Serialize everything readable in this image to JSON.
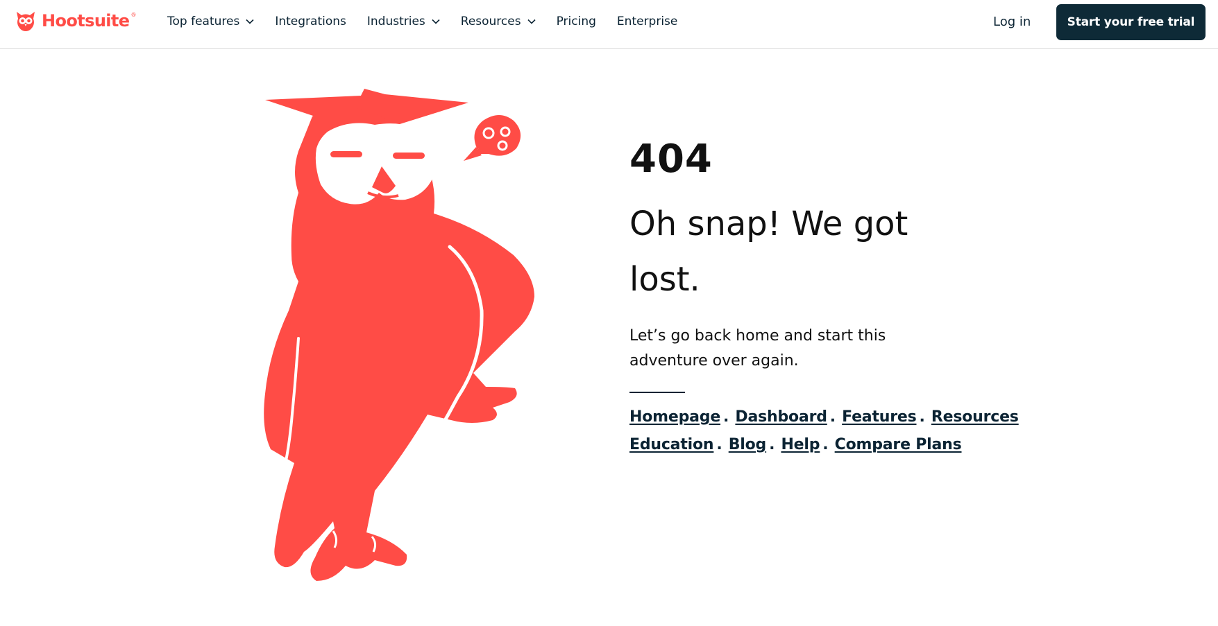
{
  "brand": {
    "name": "Hootsuite",
    "reg_mark": "®",
    "accent": "#ff4c46",
    "dark": "#0e2a37"
  },
  "nav": {
    "items": [
      {
        "label": "Top features",
        "dropdown": true
      },
      {
        "label": "Integrations",
        "dropdown": false
      },
      {
        "label": "Industries",
        "dropdown": true
      },
      {
        "label": "Resources",
        "dropdown": true
      },
      {
        "label": "Pricing",
        "dropdown": false
      },
      {
        "label": "Enterprise",
        "dropdown": false
      }
    ],
    "login_label": "Log in",
    "cta_label": "Start your free trial"
  },
  "error": {
    "code": "404",
    "heading": "Oh snap! We got lost.",
    "subtext": "Let’s go back home and start this adventure over again."
  },
  "links": [
    "Homepage",
    "Dashboard",
    "Features",
    "Resources",
    "Education",
    "Blog",
    "Help",
    "Compare Plans"
  ],
  "link_separator": ".",
  "icons": {
    "logo": "owl-logo-icon",
    "dropdown": "chevron-down-icon",
    "illustration": "owl-illustration",
    "speech": "swirl-speech-bubble-icon"
  }
}
